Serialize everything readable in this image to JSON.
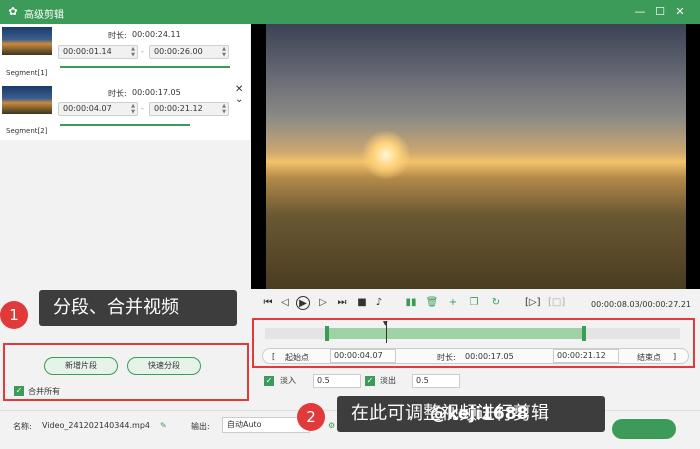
{
  "window": {
    "title": "高级剪辑"
  },
  "segments": [
    {
      "label": "Segment[1]",
      "duration_label": "时长:",
      "duration": "00:00:24.11",
      "start": "00:00:01.14",
      "end": "00:00:26.00"
    },
    {
      "label": "Segment[2]",
      "duration_label": "时长:",
      "duration": "00:00:17.05",
      "start": "00:00:04.07",
      "end": "00:00:21.12"
    }
  ],
  "player": {
    "time": "00:00:08.03/00:00:27.21"
  },
  "range": {
    "start_label": "起始点",
    "start_value": "00:00:04.07",
    "duration_label": "时长:",
    "duration_value": "00:00:17.05",
    "end_value": "00:00:21.12",
    "end_label": "结束点",
    "open_bracket": "[",
    "close_bracket": "]"
  },
  "fade": {
    "in_label": "淡入",
    "in_value": "0.5",
    "out_label": "淡出",
    "out_value": "0.5"
  },
  "left_actions": {
    "new_segment": "新增片段",
    "quick_split": "快速分段",
    "merge_all": "合并所有"
  },
  "annotations": [
    {
      "number": "1",
      "text": "分段、合并视频"
    },
    {
      "number": "2",
      "text": "在此可调整视频进行剪辑"
    }
  ],
  "bottom": {
    "name_label": "名称:",
    "filename": "Video_241202140344.mp4",
    "output_label": "输出:",
    "output_value": "自动Auto"
  },
  "watermark": "@keji1688",
  "colors": {
    "accent": "#3d9b5a",
    "highlight": "#e03a3a"
  }
}
